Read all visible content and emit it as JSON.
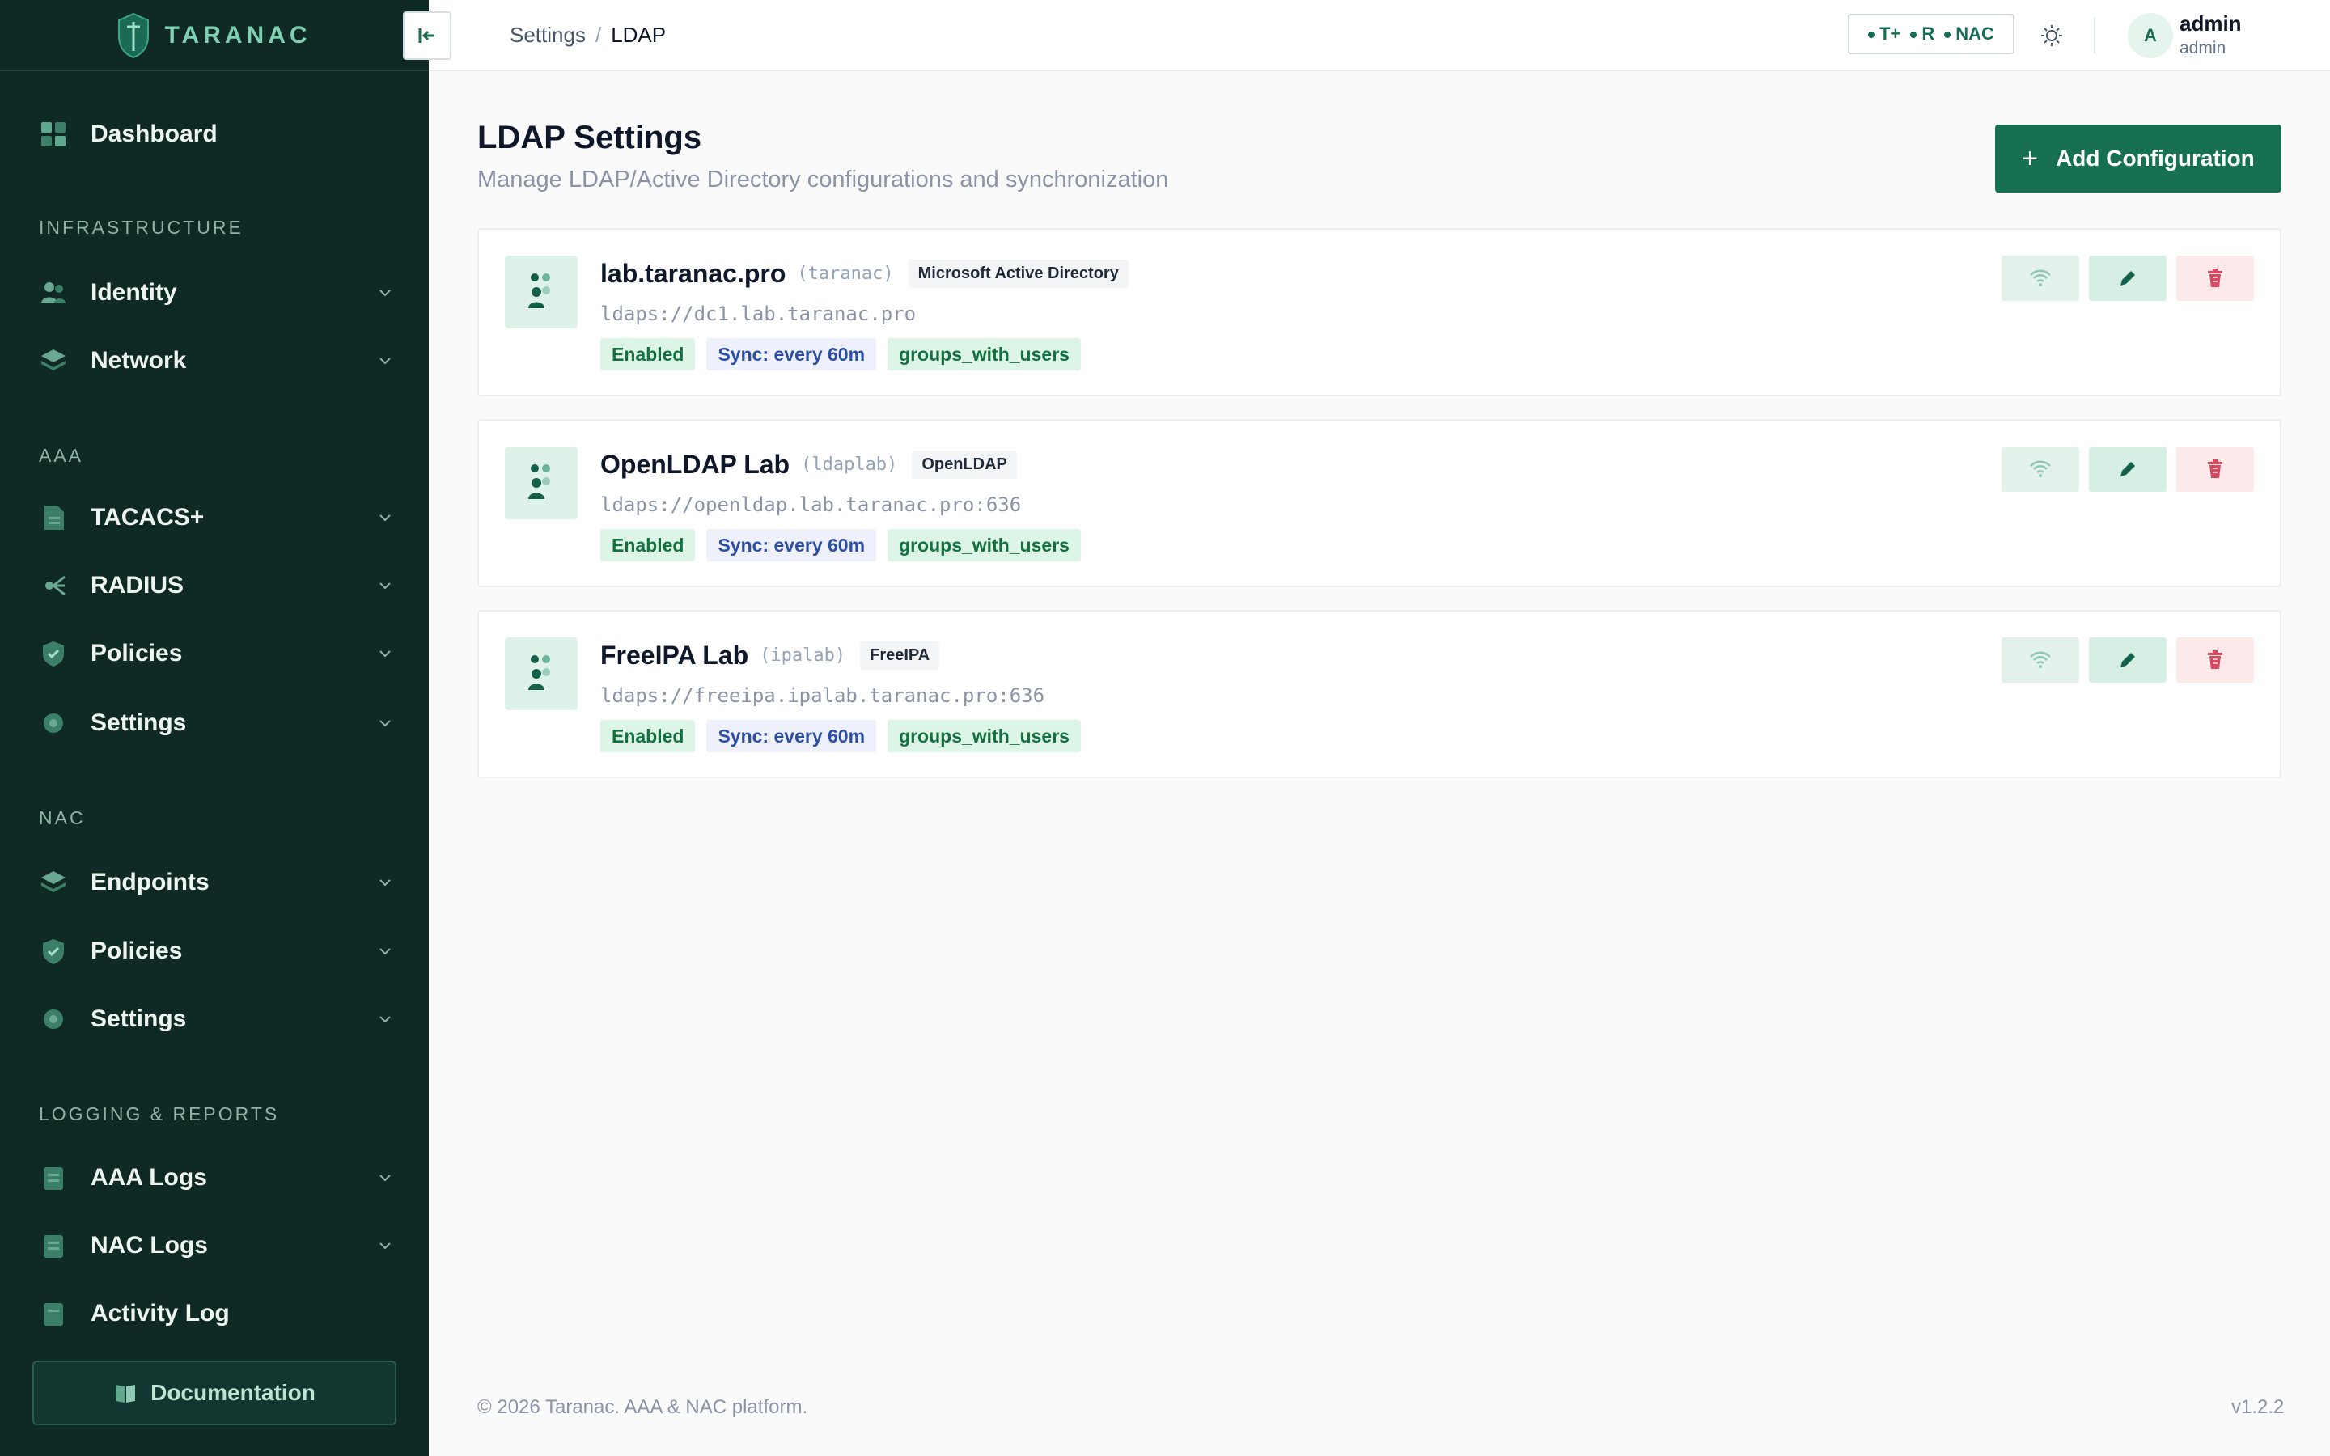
{
  "brand": {
    "name": "TARANAC"
  },
  "sidebar": {
    "items": [
      {
        "label": "Dashboard",
        "icon": "dashboard-icon"
      },
      {
        "label": "Identity",
        "icon": "users-icon"
      },
      {
        "label": "Network",
        "icon": "layers-icon"
      },
      {
        "label": "TACACS+",
        "icon": "document-icon"
      },
      {
        "label": "RADIUS",
        "icon": "radius-icon"
      },
      {
        "label": "Policies",
        "icon": "shield-check-icon"
      },
      {
        "label": "Settings",
        "icon": "gear-icon"
      },
      {
        "label": "Endpoints",
        "icon": "layers-icon"
      },
      {
        "label": "Policies",
        "icon": "shield-check-icon"
      },
      {
        "label": "Settings",
        "icon": "gear-icon"
      },
      {
        "label": "AAA Logs",
        "icon": "log-icon"
      },
      {
        "label": "NAC Logs",
        "icon": "log-icon"
      },
      {
        "label": "Activity Log",
        "icon": "log-icon"
      }
    ],
    "sections": [
      "INFRASTRUCTURE",
      "AAA",
      "NAC",
      "LOGGING & REPORTS"
    ],
    "documentation_label": "Documentation"
  },
  "header": {
    "breadcrumb": [
      "Settings",
      "/",
      "LDAP"
    ],
    "protocols": [
      "T+",
      "R",
      "NAC"
    ],
    "user": {
      "avatar": "A",
      "name": "admin",
      "role": "admin"
    }
  },
  "page": {
    "title": "LDAP Settings",
    "subtitle": "Manage LDAP/Active Directory configurations and synchronization",
    "add_button": "Add Configuration"
  },
  "configs": [
    {
      "name": "lab.taranac.pro",
      "key": "(taranac)",
      "type": "Microsoft Active Directory",
      "url": "ldaps://dc1.lab.taranac.pro",
      "status": "Enabled",
      "sync": "Sync: every 60m",
      "mode": "groups_with_users"
    },
    {
      "name": "OpenLDAP Lab",
      "key": "(ldaplab)",
      "type": "OpenLDAP",
      "url": "ldaps://openldap.lab.taranac.pro:636",
      "status": "Enabled",
      "sync": "Sync: every 60m",
      "mode": "groups_with_users"
    },
    {
      "name": "FreeIPA Lab",
      "key": "(ipalab)",
      "type": "FreeIPA",
      "url": "ldaps://freeipa.ipalab.taranac.pro:636",
      "status": "Enabled",
      "sync": "Sync: every 60m",
      "mode": "groups_with_users"
    }
  ],
  "footer": {
    "copyright": "© 2026 Taranac. AAA & NAC platform.",
    "version": "v1.2.2"
  },
  "colors": {
    "sidebar_bg": "#0f2a24",
    "accent": "#17704f",
    "danger": "#d9485f"
  }
}
